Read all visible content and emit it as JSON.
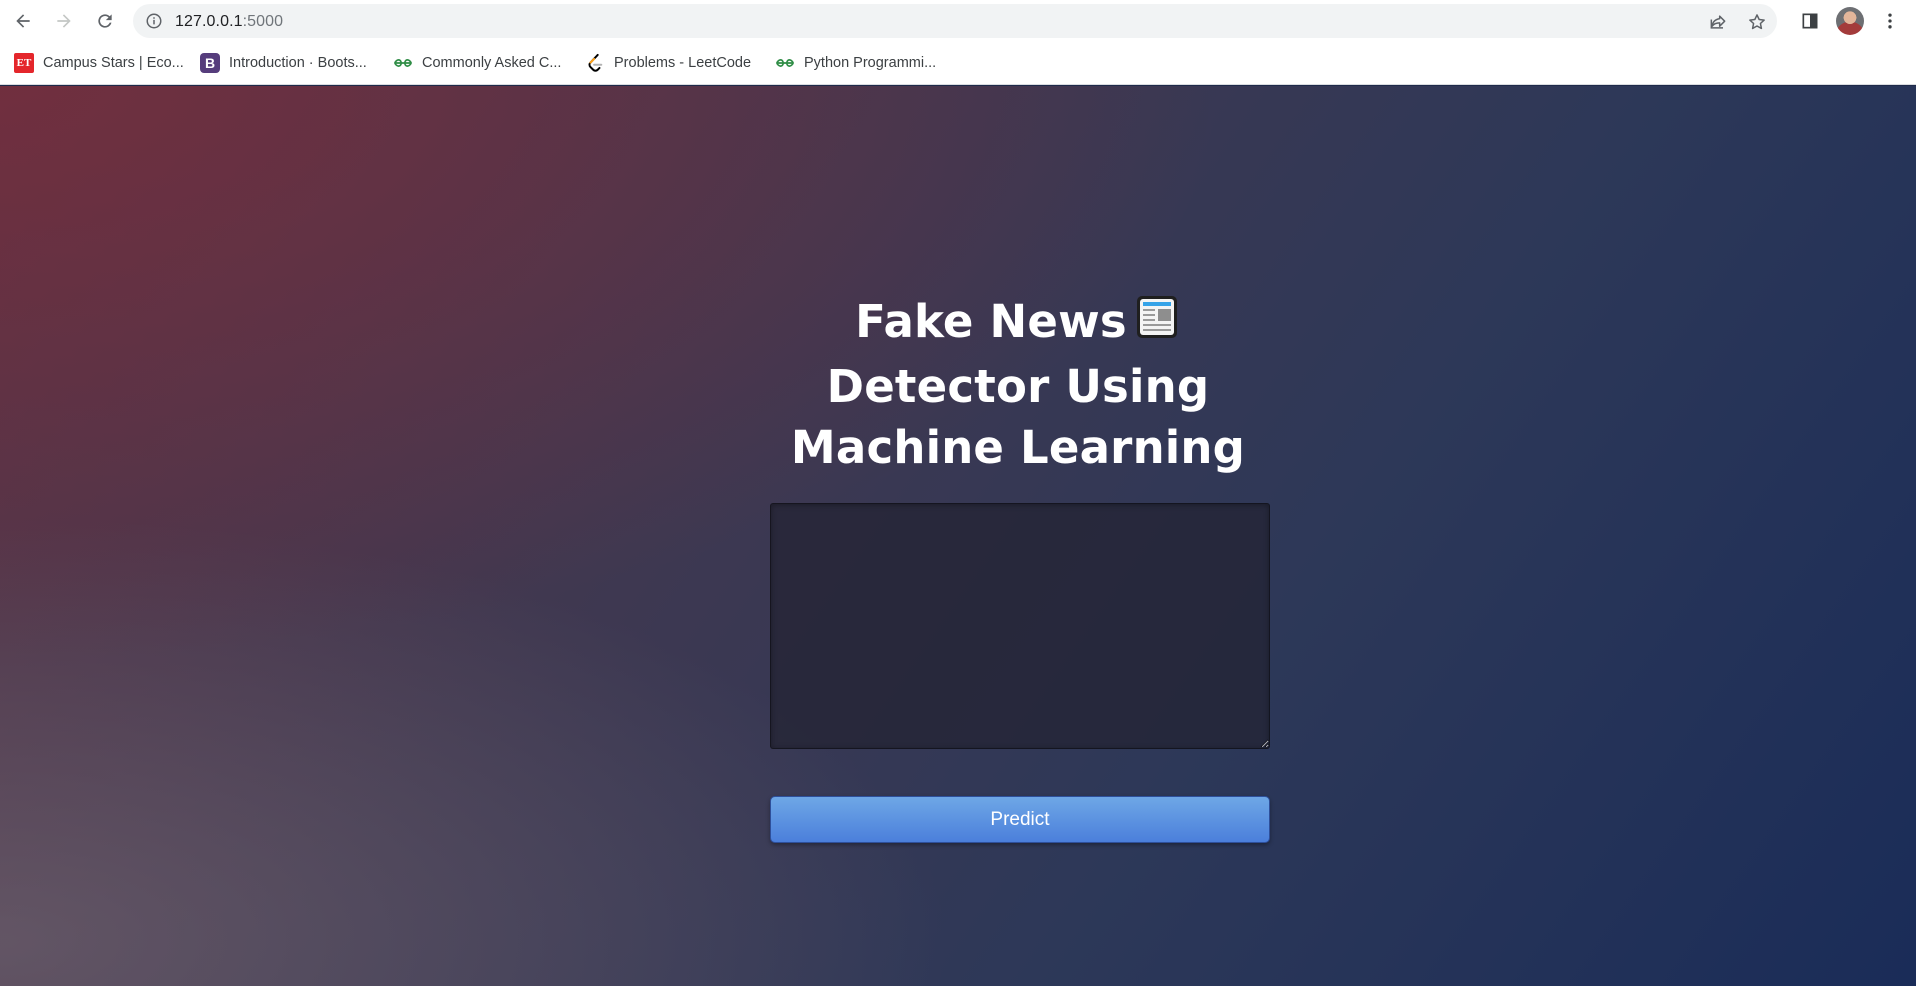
{
  "browser": {
    "url_host": "127.0.0.1",
    "url_port": ":5000",
    "bookmarks": [
      {
        "label": "Campus Stars | Eco...",
        "icon": "et-logo-icon"
      },
      {
        "label": "Introduction · Boots...",
        "icon": "bootstrap-logo-icon"
      },
      {
        "label": "Commonly Asked C...",
        "icon": "geeksforgeeks-logo-icon"
      },
      {
        "label": "Problems - LeetCode",
        "icon": "leetcode-logo-icon"
      },
      {
        "label": "Python Programmi...",
        "icon": "geeksforgeeks-logo-icon"
      }
    ]
  },
  "page": {
    "title_line1": "Fake News",
    "title_emoji": "newspaper-icon",
    "title_line2": "Detector Using",
    "title_line3": "Machine Learning",
    "textarea_value": "",
    "predict_label": "Predict"
  },
  "colors": {
    "button_top": "#6ea7e6",
    "button_bottom": "#4b7fdb",
    "bg_top_left": "#5a3446",
    "bg_bottom_right": "#1a2c58"
  }
}
